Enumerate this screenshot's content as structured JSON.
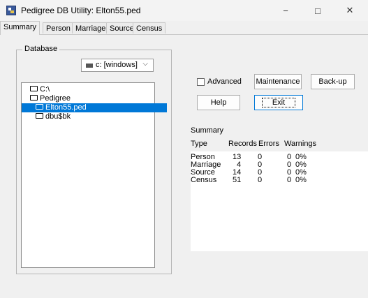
{
  "window": {
    "title": "Pedigree DB Utility: Elton55.ped",
    "minimize": "−",
    "maximize": "□",
    "close": "✕"
  },
  "tabs": [
    {
      "label": "Summary",
      "active": true
    },
    {
      "label": "Person"
    },
    {
      "label": "Marriage"
    },
    {
      "label": "Source"
    },
    {
      "label": "Census"
    }
  ],
  "database": {
    "group_label": "Database",
    "drive": "c: [windows]",
    "drive_icon": "drive-icon",
    "folders": [
      {
        "label": "C:\\",
        "icon": "folder-open-icon"
      },
      {
        "label": "Pedigree",
        "icon": "folder-open-icon"
      },
      {
        "label": "Elton55.ped",
        "icon": "folder-open-icon",
        "selected": true
      },
      {
        "label": "dbu$bk",
        "icon": "folder-icon"
      }
    ]
  },
  "controls": {
    "advanced_label": "Advanced",
    "advanced_checked": false,
    "maintenance_label": "Maintenance",
    "backup_label": "Back-up",
    "help_label": "Help",
    "exit_label": "Exit"
  },
  "summary": {
    "title": "Summary",
    "headers": [
      "Type",
      "Records",
      "Errors",
      "Warnings"
    ],
    "rows": [
      {
        "type": "Person",
        "records": "13",
        "errors": "0",
        "warnings": "0",
        "pct": "0%"
      },
      {
        "type": "Marriage",
        "records": "4",
        "errors": "0",
        "warnings": "0",
        "pct": "0%"
      },
      {
        "type": "Source",
        "records": "14",
        "errors": "0",
        "warnings": "0",
        "pct": "0%"
      },
      {
        "type": "Census",
        "records": "51",
        "errors": "0",
        "warnings": "0",
        "pct": "0%"
      }
    ]
  },
  "colors": {
    "selection": "#0078d7",
    "background": "#f0f0f0"
  }
}
